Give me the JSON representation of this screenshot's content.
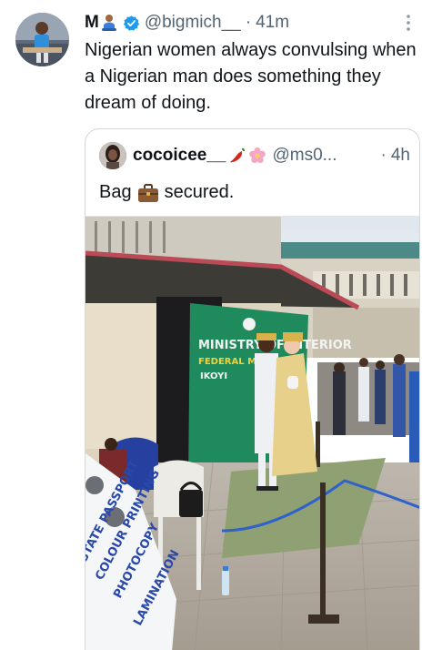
{
  "tweet": {
    "display_name": "M",
    "handle": "@bigmich__",
    "separator": "·",
    "time": "41m",
    "text": "Nigerian women always convulsing when a Nigerian man does something they dream of doing."
  },
  "quoted_tweet": {
    "display_name": "cocoicee__",
    "handle": "@ms0...",
    "separator": "·",
    "time": "4h",
    "text_before": "Bag",
    "text_after": "secured.",
    "emoji": [
      "chili-pepper",
      "cherry-blossom"
    ]
  },
  "photo": {
    "sign_lines": [
      "MINISTRY OF INTERIOR",
      "FEDERAL MARRIAGE",
      "IKOYI"
    ],
    "banner_lines": [
      "STATE PASSPORT",
      "COLOUR PRINTING",
      "PHOTOCOPY",
      "LAMINATION"
    ]
  },
  "colors": {
    "verified": "#1d9bf0",
    "secondary_text": "#536471",
    "border": "#cfd9de",
    "sign_green": "#1f8a5b"
  }
}
